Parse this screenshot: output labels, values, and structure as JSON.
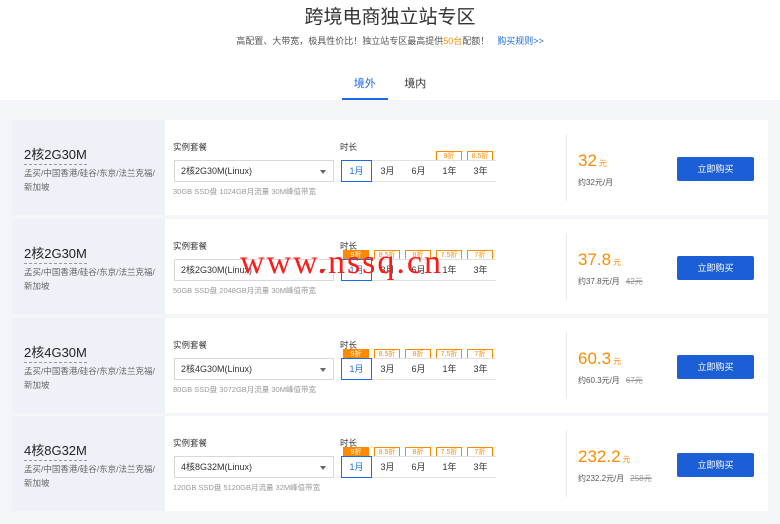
{
  "header": {
    "title": "跨境电商独立站专区",
    "subtitle_pre": "高配置、大带宽，极具性价比！独立站专区最高提供",
    "subtitle_hl": "50台",
    "subtitle_post": "配额！",
    "rules_link": "购买规则>>"
  },
  "tabs": [
    {
      "label": "境外",
      "active": true
    },
    {
      "label": "境内",
      "active": false
    }
  ],
  "labels": {
    "instance": "实例套餐",
    "duration": "时长",
    "buy": "立即购买",
    "yuan": "元"
  },
  "plans": [
    {
      "name": "2核2G30M",
      "region": "孟买/中国香港/硅谷/东京/法兰克福/新加坡",
      "select": "2核2G30M(Linux)",
      "spec": "30GB SSD盘 1024GB月流量 30M峰值带宽",
      "durations": [
        "1月",
        "3月",
        "6月",
        "1年",
        "3年"
      ],
      "badges": [
        "",
        "",
        "",
        "9折",
        "8.5折"
      ],
      "price": "32",
      "monthly": "约32元/月",
      "orig": ""
    },
    {
      "name": "2核2G30M",
      "region": "孟买/中国香港/硅谷/东京/法兰克福/新加坡",
      "select": "2核2G30M(Linux)",
      "spec": "50GB SSD盘 2048GB月流量 30M峰值带宽",
      "durations": [
        "1月",
        "3月",
        "6月",
        "1年",
        "3年"
      ],
      "badges": [
        "9折",
        "8.5折",
        "8折",
        "7.5折",
        "7折"
      ],
      "price": "37.8",
      "monthly": "约37.8元/月",
      "orig": "42元"
    },
    {
      "name": "2核4G30M",
      "region": "孟买/中国香港/硅谷/东京/法兰克福/新加坡",
      "select": "2核4G30M(Linux)",
      "spec": "80GB SSD盘 3072GB月流量 30M峰值带宽",
      "durations": [
        "1月",
        "3月",
        "6月",
        "1年",
        "3年"
      ],
      "badges": [
        "9折",
        "8.5折",
        "8折",
        "7.5折",
        "7折"
      ],
      "price": "60.3",
      "monthly": "约60.3元/月",
      "orig": "67元"
    },
    {
      "name": "4核8G32M",
      "region": "孟买/中国香港/硅谷/东京/法兰克福/新加坡",
      "select": "4核8G32M(Linux)",
      "spec": "120GB SSD盘 5120GB月流量 32M峰值带宽",
      "durations": [
        "1月",
        "3月",
        "6月",
        "1年",
        "3年"
      ],
      "badges": [
        "9折",
        "8.5折",
        "8折",
        "7.5折",
        "7折"
      ],
      "price": "232.2",
      "monthly": "约232.2元/月",
      "orig": "258元"
    }
  ],
  "watermark": "www.nssq.cn",
  "colors": {
    "accent": "#1b6ae8",
    "button": "#1b5ed6",
    "price": "#ff8a00",
    "watermark": "#ff1a1a"
  }
}
